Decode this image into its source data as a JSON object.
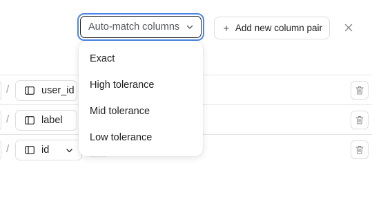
{
  "toolbar": {
    "automatch_label": "Auto-match columns",
    "add_pair_label": "Add new column pair"
  },
  "dropdown": {
    "options": [
      "Exact",
      "High tolerance",
      "Mid tolerance",
      "Low tolerance"
    ]
  },
  "rows": [
    {
      "separator": "/",
      "column": "user_id",
      "has_chevron": false
    },
    {
      "separator": "/",
      "column": "label",
      "has_chevron": false
    },
    {
      "separator": "/",
      "column": "id",
      "has_chevron": true
    }
  ],
  "colors": {
    "focus_ring": "#4b86e8",
    "border": "#dedede",
    "icon": "#8a8a8a"
  },
  "icons": {
    "automatch_chevron": "chevron-down-icon",
    "add": "plus-icon",
    "close": "close-icon",
    "column": "column-icon",
    "delete": "trash-icon"
  }
}
